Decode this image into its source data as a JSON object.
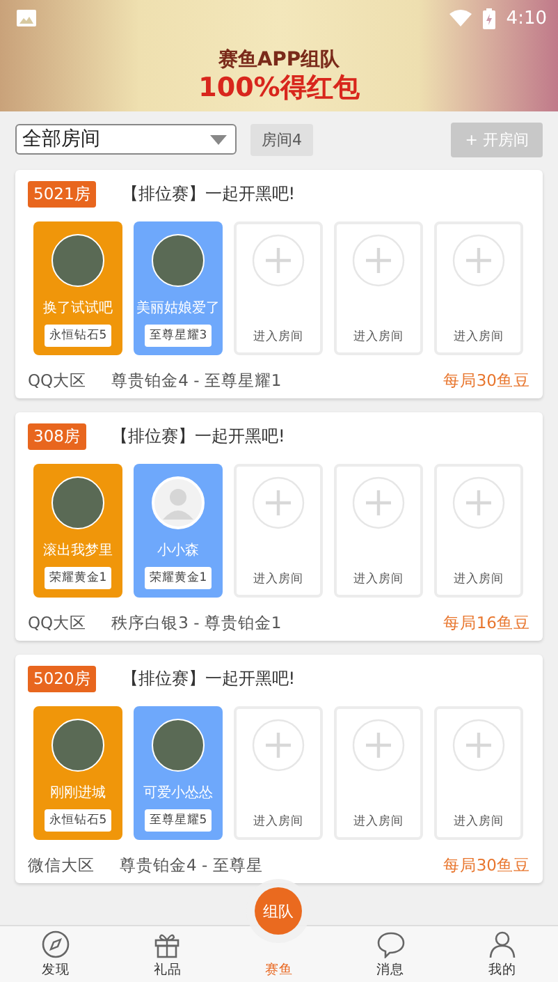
{
  "status_bar": {
    "time": "4:10"
  },
  "banner": {
    "headline": "赛鱼APP组队",
    "subline": "100%得红包"
  },
  "filter": {
    "select_value": "全部房间",
    "room_count": "房间4",
    "open_button": "+ 开房间",
    "open_disabled": true
  },
  "rooms": [
    {
      "number": "5021房",
      "title": "【排位赛】一起开黑吧!",
      "region": "QQ大区",
      "ranks": "尊贵铂金4 - 至尊星耀1",
      "price": "每局30鱼豆",
      "slots": [
        {
          "kind": "player",
          "name": "换了试试吧",
          "rank": "永恒钻石5",
          "color": "#f0960a",
          "default_avatar": false
        },
        {
          "kind": "player",
          "name": "美丽姑娘爱了",
          "rank": "至尊星耀3",
          "color": "#6ea8fb",
          "default_avatar": false
        },
        {
          "kind": "empty",
          "label": "进入房间"
        },
        {
          "kind": "empty",
          "label": "进入房间"
        },
        {
          "kind": "empty",
          "label": "进入房间"
        }
      ]
    },
    {
      "number": "308房",
      "title": "【排位赛】一起开黑吧!",
      "region": "QQ大区",
      "ranks": "秩序白银3 - 尊贵铂金1",
      "price": "每局16鱼豆",
      "slots": [
        {
          "kind": "player",
          "name": "滚出我梦里",
          "rank": "荣耀黄金1",
          "color": "#f0960a",
          "default_avatar": false
        },
        {
          "kind": "player",
          "name": "小小森",
          "rank": "荣耀黄金1",
          "color": "#6ea8fb",
          "default_avatar": true
        },
        {
          "kind": "empty",
          "label": "进入房间"
        },
        {
          "kind": "empty",
          "label": "进入房间"
        },
        {
          "kind": "empty",
          "label": "进入房间"
        }
      ]
    },
    {
      "number": "5020房",
      "title": "【排位赛】一起开黑吧!",
      "region": "微信大区",
      "ranks": "尊贵铂金4 - 至尊星",
      "price": "每局30鱼豆",
      "slots": [
        {
          "kind": "player",
          "name": "刚刚进城",
          "rank": "永恒钻石5",
          "color": "#f0960a",
          "default_avatar": false
        },
        {
          "kind": "player",
          "name": "可爱小怂怂",
          "rank": "至尊星耀5",
          "color": "#6ea8fb",
          "default_avatar": false
        },
        {
          "kind": "empty",
          "label": "进入房间"
        },
        {
          "kind": "empty",
          "label": "进入房间"
        },
        {
          "kind": "empty",
          "label": "进入房间"
        }
      ]
    }
  ],
  "nav": {
    "fab": "组队",
    "items": [
      {
        "label": "发现",
        "selected": false
      },
      {
        "label": "礼品",
        "selected": false
      },
      {
        "label": "赛鱼",
        "selected": true
      },
      {
        "label": "消息",
        "selected": false
      },
      {
        "label": "我的",
        "selected": false
      }
    ]
  }
}
